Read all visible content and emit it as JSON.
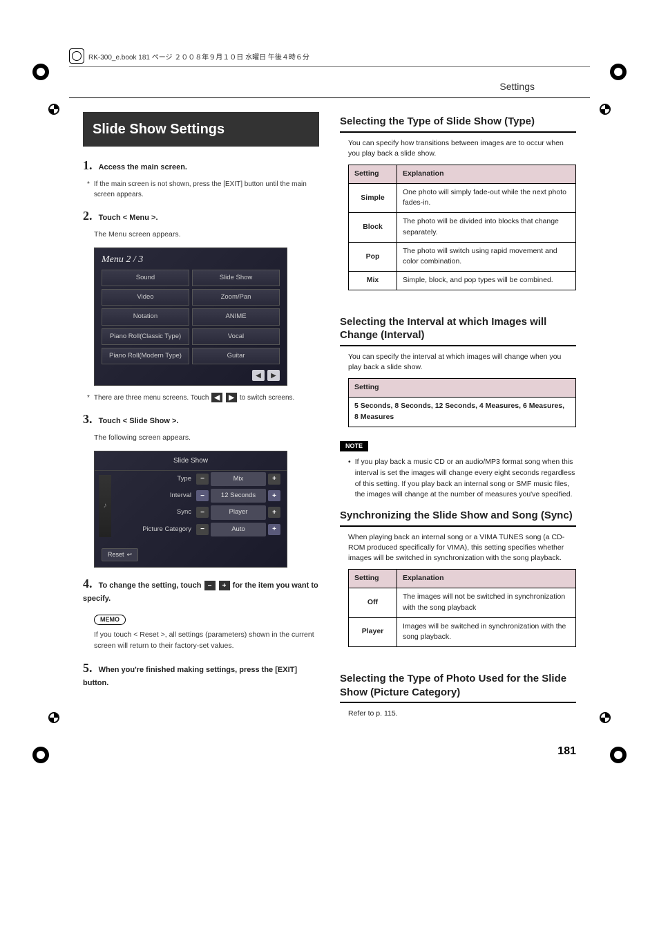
{
  "header": {
    "book_ref": "RK-300_e.book 181 ページ ２００８年９月１０日 水曜日 午後４時６分",
    "section": "Settings"
  },
  "left": {
    "title_box": "Slide Show Settings",
    "step1_num": "1.",
    "step1_text": "Access the main screen.",
    "step1_note": "If the main screen is not shown, press the [EXIT] button until the main screen appears.",
    "step2_num": "2.",
    "step2_text": "Touch < Menu >.",
    "step2_sub": "The Menu screen appears.",
    "menu_shot": {
      "title": "Menu 2 / 3",
      "rows": [
        [
          "Sound",
          "Slide Show"
        ],
        [
          "Video",
          "Zoom/Pan"
        ],
        [
          "Notation",
          "ANIME"
        ],
        [
          "Piano Roll(Classic Type)",
          "Vocal"
        ],
        [
          "Piano Roll(Modern Type)",
          "Guitar"
        ]
      ]
    },
    "step2_note_pre": "There are three menu screens. Touch ",
    "step2_note_post": " to switch screens.",
    "step3_num": "3.",
    "step3_text": "Touch < Slide Show >.",
    "step3_sub": "The following screen appears.",
    "slide_shot": {
      "title": "Slide Show",
      "rows": [
        {
          "label": "Type",
          "value": "Mix"
        },
        {
          "label": "Interval",
          "value": "12 Seconds"
        },
        {
          "label": "Sync",
          "value": "Player"
        },
        {
          "label": "Picture Category",
          "value": "Auto"
        }
      ],
      "reset": "Reset"
    },
    "step4_num": "4.",
    "step4_text_pre": "To change the setting, touch ",
    "step4_text_post": " for the item you want to specify.",
    "memo_label": "MEMO",
    "memo_text": "If you touch < Reset >, all settings (parameters) shown in the current screen will return to their factory-set values.",
    "step5_num": "5.",
    "step5_text": "When you're finished making settings, press the [EXIT] button."
  },
  "right": {
    "sec1_h": "Selecting the Type of Slide Show (Type)",
    "sec1_p": "You can specify how transitions between images are to occur when you play back a slide show.",
    "tbl1_h1": "Setting",
    "tbl1_h2": "Explanation",
    "tbl1": [
      {
        "s": "Simple",
        "e": "One photo will simply fade-out while the next photo fades-in."
      },
      {
        "s": "Block",
        "e": "The photo will be divided into blocks that change separately."
      },
      {
        "s": "Pop",
        "e": "The photo will switch using rapid movement and color combination."
      },
      {
        "s": "Mix",
        "e": "Simple, block, and pop types will be combined."
      }
    ],
    "sec2_h": "Selecting the Interval at which Images will Change (Interval)",
    "sec2_p": "You can specify the interval at which images will change when you play back a slide show.",
    "tbl2_h": "Setting",
    "tbl2_val": "5 Seconds, 8 Seconds, 12 Seconds, 4 Measures, 6 Measures, 8 Measures",
    "note_label": "NOTE",
    "note_text": "If you play back a music CD or an audio/MP3 format song when this interval is set the images will change every eight seconds regardless of this setting. If you play back an internal song or SMF music files, the images will change at the number of measures you've specified.",
    "sec3_h": "Synchronizing the Slide Show and Song (Sync)",
    "sec3_p": "When playing back an internal song or a VIMA TUNES song (a CD-ROM produced specifically for VIMA), this setting specifies whether images will be switched in synchronization with the song playback.",
    "tbl3_h1": "Setting",
    "tbl3_h2": "Explanation",
    "tbl3": [
      {
        "s": "Off",
        "e": "The images will not be switched in synchronization with the song playback"
      },
      {
        "s": "Player",
        "e": "Images will be switched in synchronization with the song playback."
      }
    ],
    "sec4_h": "Selecting the Type of Photo Used for the Slide Show (Picture Category)",
    "sec4_p": "Refer to p. 115."
  },
  "page_num": "181",
  "icons": {
    "minus": "−",
    "plus": "+",
    "left": "◀",
    "right": "▶"
  }
}
